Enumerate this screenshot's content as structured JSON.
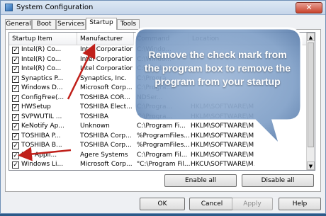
{
  "window": {
    "title": "System Configuration",
    "close_glyph": "✕"
  },
  "tabs": [
    "General",
    "Boot",
    "Services",
    "Startup",
    "Tools"
  ],
  "active_tab": "Startup",
  "list": {
    "columns": [
      "Startup Item",
      "Manufacturer",
      "Command",
      "Location"
    ],
    "rows": [
      {
        "item": "Intel(R) Co...",
        "maker": "Intel Corporation",
        "command": "C:\\Windo...",
        "location": "",
        "checked": true
      },
      {
        "item": "Intel(R) Co...",
        "maker": "Intel Corporation",
        "command": "C:\\Windo...",
        "location": "",
        "checked": true
      },
      {
        "item": "Intel(R) Co...",
        "maker": "Intel Corporation",
        "command": "C:\\Windo...",
        "location": "",
        "checked": true
      },
      {
        "item": "Synaptics P...",
        "maker": "Synaptics, Inc.",
        "command": "C:\\Progra...",
        "location": "",
        "checked": true
      },
      {
        "item": "Windows D...",
        "maker": "Microsoft Corp...",
        "command": "C:\\Progra...",
        "location": "",
        "checked": true
      },
      {
        "item": "ConfigFree(...",
        "maker": "TOSHIBA COR...",
        "command": "NDSer...",
        "location": "",
        "checked": true
      },
      {
        "item": "HWSetup",
        "maker": "TOSHIBA Elect...",
        "command": "C:\\Progra...",
        "location": "HKLM\\SOFTWARE\\M...",
        "checked": true
      },
      {
        "item": "SVPWUTIL ...",
        "maker": "TOSHIBA",
        "command": "C:\\Progra...",
        "location": "HKLM\\SOFTWARE\\M...",
        "checked": true
      },
      {
        "item": "KeNotify Ap...",
        "maker": "Unknown",
        "command": "C:\\Program Fi...",
        "location": "HKLM\\SOFTWARE\\M...",
        "checked": true
      },
      {
        "item": "TOSHIBA P...",
        "maker": "TOSHIBA Corp...",
        "command": "%ProgramFiles...",
        "location": "HKLM\\SOFTWARE\\M...",
        "checked": true
      },
      {
        "item": "TOSHIBA B...",
        "maker": "TOSHIBA Corp...",
        "command": "%ProgramFiles...",
        "location": "HKLM\\SOFTWARE\\M...",
        "checked": true
      },
      {
        "item": "Li... Appli...",
        "maker": "Agere Systems",
        "command": "C:\\Program Fil...",
        "location": "HKLM\\SOFTWARE\\M...",
        "checked": true
      },
      {
        "item": "Windows Li...",
        "maker": "Microsoft Corp...",
        "command": "\"C:\\Program Fil...",
        "location": "HKCU\\SOFTWARE\\M...",
        "checked": true
      }
    ]
  },
  "buttons": {
    "enable_all": "Enable all",
    "disable_all": "Disable all",
    "ok": "OK",
    "cancel": "Cancel",
    "apply": "Apply",
    "help": "Help"
  },
  "callout": {
    "text": "Remove the check mark from the program box to remove the program from your startup"
  },
  "colors": {
    "callout_fill": "#7f9fc7",
    "arrow": "#c0201a"
  }
}
